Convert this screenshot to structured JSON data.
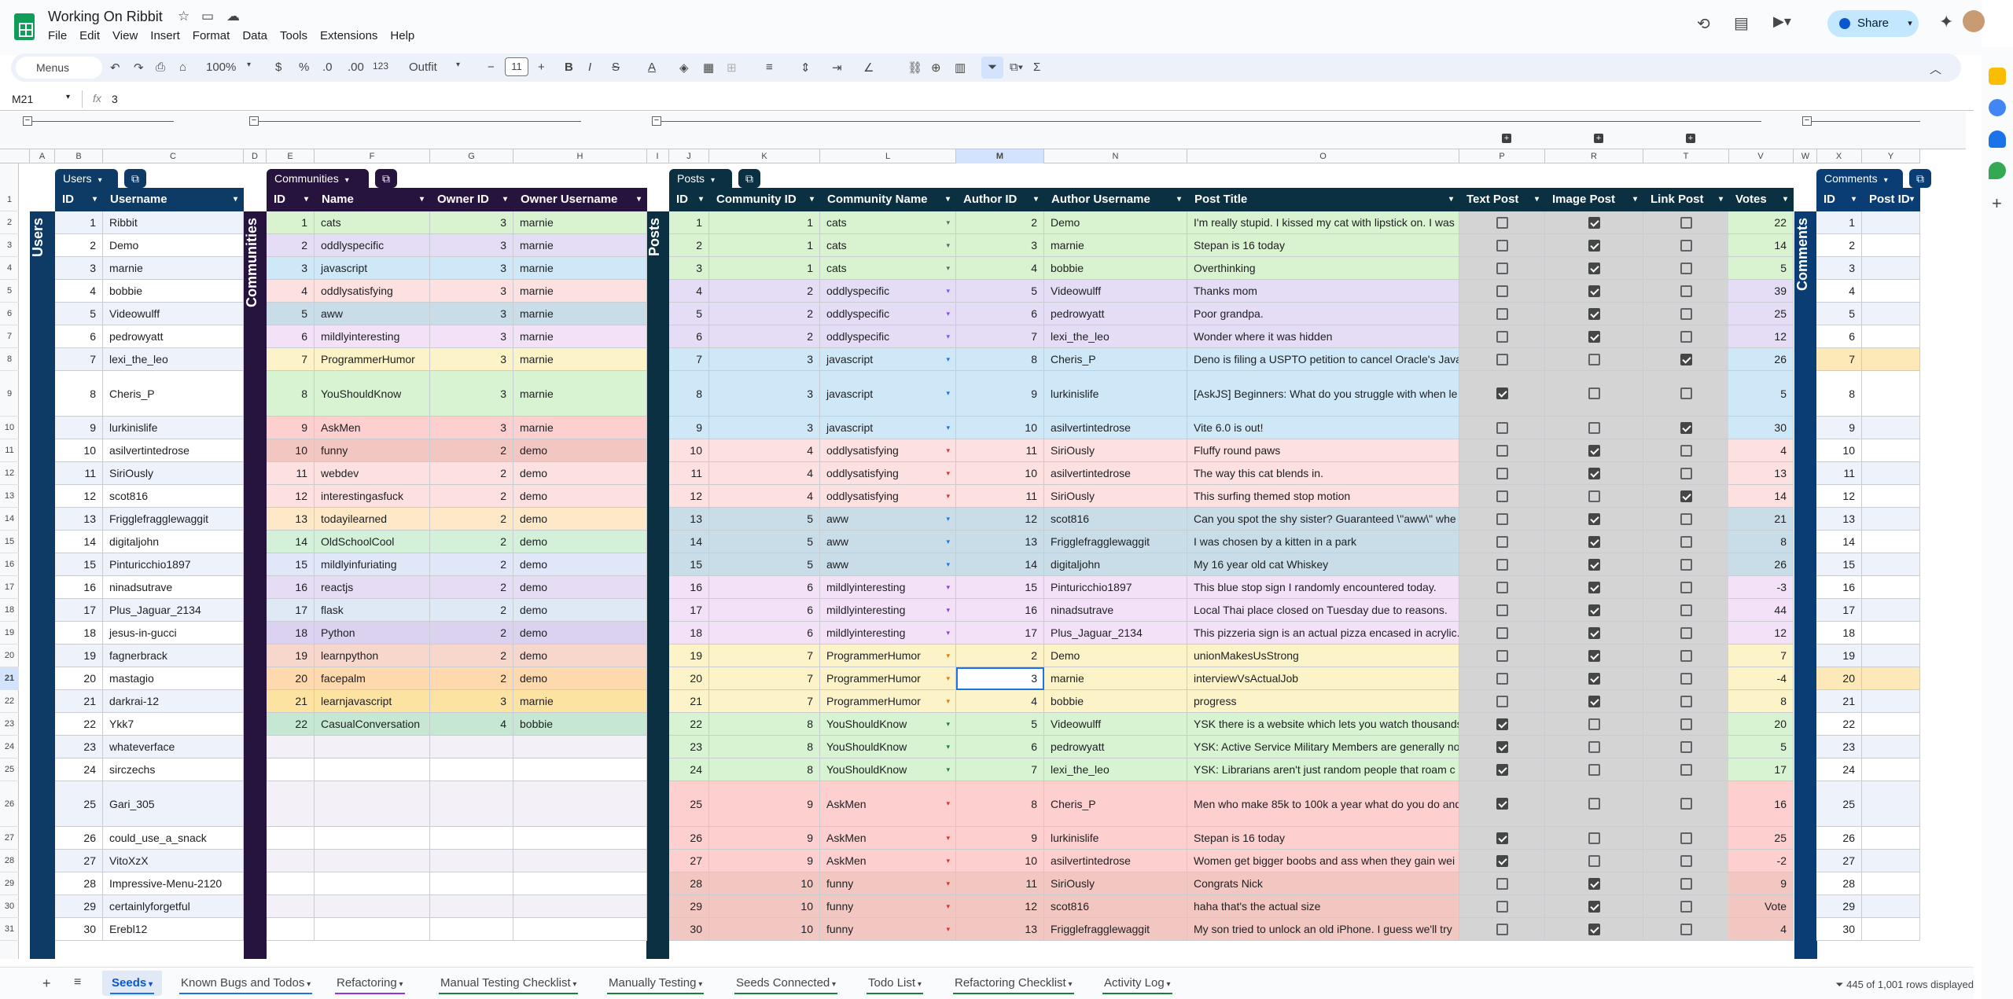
{
  "doc": {
    "title": "Working On Ribbit",
    "menus": [
      "File",
      "Edit",
      "View",
      "Insert",
      "Format",
      "Data",
      "Tools",
      "Extensions",
      "Help"
    ],
    "share": "Share"
  },
  "toolbar": {
    "menus": "Menus",
    "zoom": "100%",
    "currency": "$",
    "percent": "%",
    "dec_less": ".0",
    "dec_more": ".00",
    "num_format": "123",
    "font": "Outfit",
    "font_size": "11",
    "bold": "B",
    "italic": "I",
    "strike": "S",
    "textcolor": "A",
    "sum": "Σ"
  },
  "formula": {
    "cell": "M21",
    "fx": "fx",
    "value": "3"
  },
  "colors": {
    "users": "#0d3b66",
    "communities": "#26143f",
    "posts": "#0b3042",
    "comments": "#0a3d73",
    "selected": "#1a73e8"
  },
  "columns": [
    "A",
    "B",
    "C",
    "D",
    "E",
    "F",
    "G",
    "H",
    "I",
    "J",
    "K",
    "L",
    "M",
    "N",
    "O",
    "P",
    "R",
    "T",
    "V",
    "W",
    "X",
    "Y"
  ],
  "rows": [
    "1",
    "2",
    "3",
    "4",
    "5",
    "6",
    "7",
    "8",
    "9",
    "10",
    "11",
    "12",
    "13",
    "14",
    "15",
    "16",
    "17",
    "18",
    "19",
    "20",
    "21",
    "22",
    "23",
    "24",
    "25",
    "26",
    "27",
    "28",
    "29",
    "30",
    "31"
  ],
  "tables": {
    "users": {
      "title": "Users",
      "strip": "Users",
      "headers": [
        "ID",
        "Username"
      ],
      "data": [
        [
          "1",
          "Ribbit"
        ],
        [
          "2",
          "Demo"
        ],
        [
          "3",
          "marnie"
        ],
        [
          "4",
          "bobbie"
        ],
        [
          "5",
          "Videowulff"
        ],
        [
          "6",
          "pedrowyatt"
        ],
        [
          "7",
          "lexi_the_leo"
        ],
        [
          "8",
          "Cheris_P"
        ],
        [
          "9",
          "lurkinislife"
        ],
        [
          "10",
          "asilvertintedrose"
        ],
        [
          "11",
          "SiriOusly"
        ],
        [
          "12",
          "scot816"
        ],
        [
          "13",
          "Frigglefragglewaggit"
        ],
        [
          "14",
          "digitaljohn"
        ],
        [
          "15",
          "Pinturicchio1897"
        ],
        [
          "16",
          "ninadsutrave"
        ],
        [
          "17",
          "Plus_Jaguar_2134"
        ],
        [
          "18",
          "jesus-in-gucci"
        ],
        [
          "19",
          "fagnerbrack"
        ],
        [
          "20",
          "mastagio"
        ],
        [
          "21",
          "darkrai-12"
        ],
        [
          "22",
          "Ykk7"
        ],
        [
          "23",
          "whateverface"
        ],
        [
          "24",
          "sirczechs"
        ],
        [
          "25",
          "Gari_305"
        ],
        [
          "26",
          "could_use_a_snack"
        ],
        [
          "27",
          "VitoXzX"
        ],
        [
          "28",
          "Impressive-Menu-2120"
        ],
        [
          "29",
          "certainlyforgetful"
        ],
        [
          "30",
          "Erebl12"
        ]
      ]
    },
    "communities": {
      "title": "Communities",
      "strip": "Communities",
      "headers": [
        "ID",
        "Name",
        "Owner ID",
        "Owner Username"
      ],
      "data": [
        [
          "1",
          "cats",
          "3",
          "marnie"
        ],
        [
          "2",
          "oddlyspecific",
          "3",
          "marnie"
        ],
        [
          "3",
          "javascript",
          "3",
          "marnie"
        ],
        [
          "4",
          "oddlysatisfying",
          "3",
          "marnie"
        ],
        [
          "5",
          "aww",
          "3",
          "marnie"
        ],
        [
          "6",
          "mildlyinteresting",
          "3",
          "marnie"
        ],
        [
          "7",
          "ProgrammerHumor",
          "3",
          "marnie"
        ],
        [
          "8",
          "YouShouldKnow",
          "3",
          "marnie"
        ],
        [
          "9",
          "AskMen",
          "3",
          "marnie"
        ],
        [
          "10",
          "funny",
          "2",
          "demo"
        ],
        [
          "11",
          "webdev",
          "2",
          "demo"
        ],
        [
          "12",
          "interestingasfuck",
          "2",
          "demo"
        ],
        [
          "13",
          "todayilearned",
          "2",
          "demo"
        ],
        [
          "14",
          "OldSchoolCool",
          "2",
          "demo"
        ],
        [
          "15",
          "mildlyinfuriating",
          "2",
          "demo"
        ],
        [
          "16",
          "reactjs",
          "2",
          "demo"
        ],
        [
          "17",
          "flask",
          "2",
          "demo"
        ],
        [
          "18",
          "Python",
          "2",
          "demo"
        ],
        [
          "19",
          "learnpython",
          "2",
          "demo"
        ],
        [
          "20",
          "facepalm",
          "2",
          "demo"
        ],
        [
          "21",
          "learnjavascript",
          "3",
          "marnie"
        ],
        [
          "22",
          "CasualConversation",
          "4",
          "bobbie"
        ]
      ]
    },
    "posts": {
      "title": "Posts",
      "strip": "Posts",
      "headers": [
        "ID",
        "Community ID",
        "Community Name",
        "Author ID",
        "Author Username",
        "Post Title",
        "Text Post",
        "Image Post",
        "Link Post",
        "Votes"
      ],
      "data": [
        [
          "1",
          "1",
          "cats",
          "2",
          "Demo",
          "I'm really stupid. I kissed my cat with lipstick on. I was",
          false,
          true,
          false,
          "22"
        ],
        [
          "2",
          "1",
          "cats",
          "3",
          "marnie",
          "Stepan is 16 today",
          false,
          true,
          false,
          "14"
        ],
        [
          "3",
          "1",
          "cats",
          "4",
          "bobbie",
          "Overthinking",
          false,
          true,
          false,
          "5"
        ],
        [
          "4",
          "2",
          "oddlyspecific",
          "5",
          "Videowulff",
          "Thanks mom",
          false,
          true,
          false,
          "39"
        ],
        [
          "5",
          "2",
          "oddlyspecific",
          "6",
          "pedrowyatt",
          "Poor grandpa.",
          false,
          true,
          false,
          "25"
        ],
        [
          "6",
          "2",
          "oddlyspecific",
          "7",
          "lexi_the_leo",
          "Wonder where it was hidden",
          false,
          true,
          false,
          "12"
        ],
        [
          "7",
          "3",
          "javascript",
          "8",
          "Cheris_P",
          "Deno is filing a USPTO petition to cancel Oracle's Java",
          false,
          false,
          true,
          "26"
        ],
        [
          "8",
          "3",
          "javascript",
          "9",
          "lurkinislife",
          "[AskJS] Beginners: What do you struggle with when le",
          true,
          false,
          false,
          "5"
        ],
        [
          "9",
          "3",
          "javascript",
          "10",
          "asilvertintedrose",
          "Vite 6.0 is out!",
          false,
          false,
          true,
          "30"
        ],
        [
          "10",
          "4",
          "oddlysatisfying",
          "11",
          "SiriOusly",
          "Fluffy round paws",
          false,
          true,
          false,
          "4"
        ],
        [
          "11",
          "4",
          "oddlysatisfying",
          "10",
          "asilvertintedrose",
          "The way this cat blends in.",
          false,
          true,
          false,
          "13"
        ],
        [
          "12",
          "4",
          "oddlysatisfying",
          "11",
          "SiriOusly",
          "This surfing themed stop motion",
          false,
          false,
          true,
          "14"
        ],
        [
          "13",
          "5",
          "aww",
          "12",
          "scot816",
          "Can you spot the shy sister? Guaranteed \\\"aww\\\" whe",
          false,
          true,
          false,
          "21"
        ],
        [
          "14",
          "5",
          "aww",
          "13",
          "Frigglefragglewaggit",
          "I was chosen by a kitten in a park",
          false,
          true,
          false,
          "8"
        ],
        [
          "15",
          "5",
          "aww",
          "14",
          "digitaljohn",
          "My 16 year old cat Whiskey",
          false,
          true,
          false,
          "26"
        ],
        [
          "16",
          "6",
          "mildlyinteresting",
          "15",
          "Pinturicchio1897",
          "This blue stop sign I randomly encountered today.",
          false,
          true,
          false,
          "-3"
        ],
        [
          "17",
          "6",
          "mildlyinteresting",
          "16",
          "ninadsutrave",
          "Local Thai place closed on Tuesday due to reasons.",
          false,
          true,
          false,
          "44"
        ],
        [
          "18",
          "6",
          "mildlyinteresting",
          "17",
          "Plus_Jaguar_2134",
          "This pizzeria sign is an actual pizza encased in acrylic.",
          false,
          true,
          false,
          "12"
        ],
        [
          "19",
          "7",
          "ProgrammerHumor",
          "2",
          "Demo",
          "unionMakesUsStrong",
          false,
          true,
          false,
          "7"
        ],
        [
          "20",
          "7",
          "ProgrammerHumor",
          "3",
          "marnie",
          "interviewVsActualJob",
          false,
          true,
          false,
          "-4"
        ],
        [
          "21",
          "7",
          "ProgrammerHumor",
          "4",
          "bobbie",
          "progress",
          false,
          true,
          false,
          "8"
        ],
        [
          "22",
          "8",
          "YouShouldKnow",
          "5",
          "Videowulff",
          "YSK there is a website which lets you watch thousands",
          true,
          false,
          false,
          "20"
        ],
        [
          "23",
          "8",
          "YouShouldKnow",
          "6",
          "pedrowyatt",
          "YSK: Active Service Military Members are generally no",
          true,
          false,
          false,
          "5"
        ],
        [
          "24",
          "8",
          "YouShouldKnow",
          "7",
          "lexi_the_leo",
          "YSK: Librarians aren't just random people that roam c",
          true,
          false,
          false,
          "17"
        ],
        [
          "25",
          "9",
          "AskMen",
          "8",
          "Cheris_P",
          "Men who make 85k to 100k a year what do you do and",
          true,
          false,
          false,
          "16"
        ],
        [
          "26",
          "9",
          "AskMen",
          "9",
          "lurkinislife",
          "Stepan is 16 today",
          true,
          false,
          false,
          "25"
        ],
        [
          "27",
          "9",
          "AskMen",
          "10",
          "asilvertintedrose",
          "Women get bigger boobs and ass when they gain wei",
          true,
          false,
          false,
          "-2"
        ],
        [
          "28",
          "10",
          "funny",
          "11",
          "SiriOusly",
          "Congrats Nick",
          false,
          true,
          false,
          "9"
        ],
        [
          "29",
          "10",
          "funny",
          "12",
          "scot816",
          "haha that's the actual size",
          false,
          true,
          false,
          "Vote"
        ],
        [
          "30",
          "10",
          "funny",
          "13",
          "Frigglefragglewaggit",
          "My son tried to unlock an old iPhone. I guess we'll try",
          false,
          true,
          false,
          "4"
        ]
      ]
    },
    "comments": {
      "title": "Comments",
      "strip": "Comments",
      "headers": [
        "ID",
        "Post ID"
      ],
      "data": [
        "1",
        "2",
        "3",
        "4",
        "5",
        "6",
        "7",
        "8",
        "9",
        "10",
        "11",
        "12",
        "13",
        "14",
        "15",
        "16",
        "17",
        "18",
        "19",
        "20",
        "21",
        "22",
        "23",
        "24",
        "25",
        "26",
        "27",
        "28",
        "29",
        "30"
      ]
    }
  },
  "sheets": [
    "Seeds",
    "Known Bugs and Todos",
    "Refactoring",
    "Manual Testing Checklist",
    "Manually Testing",
    "Seeds Connected",
    "Todo List",
    "Refactoring Checklist",
    "Activity Log"
  ],
  "status": "445 of 1,001 rows displayed"
}
